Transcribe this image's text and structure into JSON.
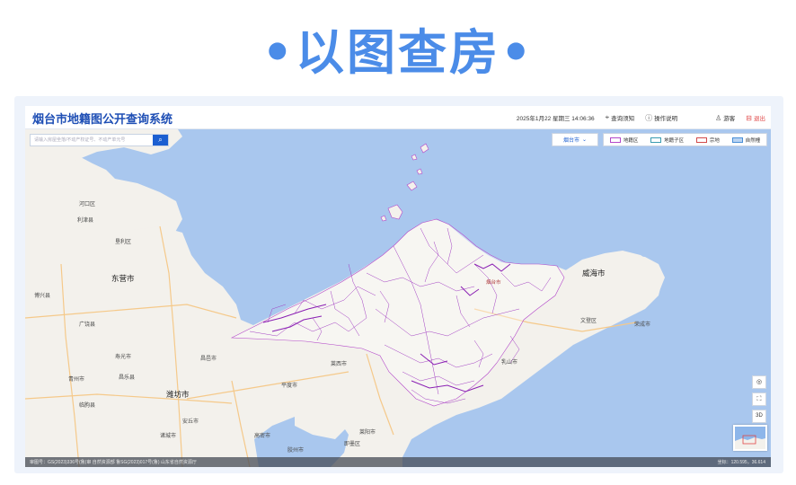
{
  "banner": {
    "title": "•以图查房•"
  },
  "header": {
    "app_title": "烟台市地籍图公开查询系统",
    "datetime": "2025年1月22 星期三 14:06:36",
    "query_notice": "查询须知",
    "guide": "操作说明",
    "user": "游客",
    "logout": "退出"
  },
  "search": {
    "placeholder": "请输入房屋坐落/不动产权证号、不动产单元号",
    "button_icon": "search-icon"
  },
  "city_select": {
    "value": "烟台市"
  },
  "legend": {
    "items": [
      {
        "label": "地籍区",
        "color": "#b347c9"
      },
      {
        "label": "地籍子区",
        "color": "#3a9bb0"
      },
      {
        "label": "宗地",
        "color": "#d24a4a"
      },
      {
        "label": "自然幢",
        "color": "#4a8fd6"
      }
    ]
  },
  "controls": {
    "compass": "compass-icon",
    "fullscreen": "fullscreen-icon",
    "mode": "3D"
  },
  "footer": {
    "left": "审图号：GS(2023)336号(鲁)审 自然资源部 鲁SG(2023)017号(鲁) 山东省自然资源厅",
    "right": "坐标：120.595，36.614"
  },
  "map_labels": [
    {
      "text": "东营市",
      "big": true
    },
    {
      "text": "潍坊市",
      "big": true
    },
    {
      "text": "威海市",
      "big": true
    },
    {
      "text": "烟台市",
      "big": true
    },
    {
      "text": "利津县"
    },
    {
      "text": "垦利区"
    },
    {
      "text": "河口区"
    },
    {
      "text": "广饶县"
    },
    {
      "text": "寿光市"
    },
    {
      "text": "青州市"
    },
    {
      "text": "昌乐县"
    },
    {
      "text": "临朐县"
    },
    {
      "text": "昌邑市"
    },
    {
      "text": "平度市"
    },
    {
      "text": "安丘市"
    },
    {
      "text": "高密市"
    },
    {
      "text": "胶州市"
    },
    {
      "text": "莱西市"
    },
    {
      "text": "即墨区"
    },
    {
      "text": "乳山市"
    },
    {
      "text": "文登区"
    },
    {
      "text": "荣成市"
    },
    {
      "text": "城阳区"
    },
    {
      "text": "莱阳市"
    },
    {
      "text": "博兴县"
    },
    {
      "text": "诸城市"
    }
  ]
}
